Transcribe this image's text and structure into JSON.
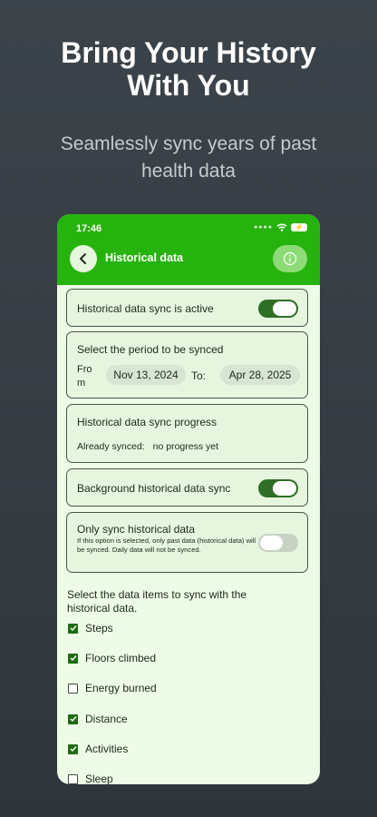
{
  "promo": {
    "headline_line1": "Bring Your History",
    "headline_line2": "With You",
    "subtitle_line1": "Seamlessly sync years of past",
    "subtitle_line2": "health data"
  },
  "status_bar": {
    "time": "17:46"
  },
  "app_bar": {
    "title": "Historical data",
    "back_icon": "chevron-left-icon",
    "info_icon": "info-icon"
  },
  "sync_active": {
    "label": "Historical data sync is active",
    "enabled": true
  },
  "period": {
    "label": "Select the period to be synced",
    "from_label_line1": "Fro",
    "from_label_line2": "m",
    "from_value": "Nov 13, 2024",
    "to_label": "To:",
    "to_value": "Apr 28, 2025"
  },
  "progress": {
    "label": "Historical data sync progress",
    "synced_label": "Already synced:",
    "synced_value": "no progress yet"
  },
  "background_sync": {
    "label": "Background historical data sync",
    "enabled": true
  },
  "only_historical": {
    "label": "Only sync historical data",
    "description": "If this option is selected, only past data (historical data) will be synced. Daily data will not be synced.",
    "enabled": false
  },
  "items_section": {
    "label": "Select the data items to sync with the historical data.",
    "items": [
      {
        "label": "Steps",
        "checked": true
      },
      {
        "label": "Floors climbed",
        "checked": true
      },
      {
        "label": "Energy burned",
        "checked": false
      },
      {
        "label": "Distance",
        "checked": true
      },
      {
        "label": "Activities",
        "checked": true
      },
      {
        "label": "Sleep",
        "checked": false
      }
    ]
  },
  "colors": {
    "app_green": "#27b30e",
    "toggle_on": "#2f6e25",
    "page_bg": "#edfbe7"
  }
}
